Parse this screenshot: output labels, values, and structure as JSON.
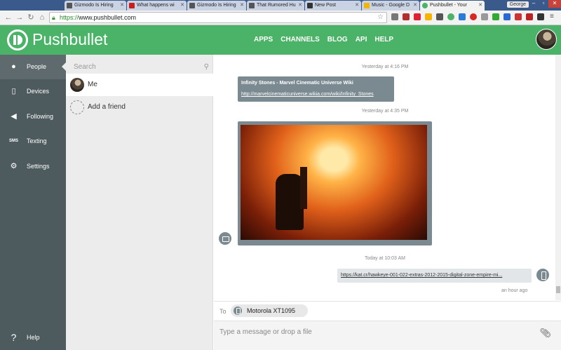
{
  "browser": {
    "tabs": [
      {
        "label": "Gizmodo Is Hiring",
        "icon": "gizmodo-favicon",
        "color": "#555555"
      },
      {
        "label": "What happens wi",
        "icon": "s-favicon",
        "color": "#c81e1e"
      },
      {
        "label": "Gizmodo Is Hiring",
        "icon": "gizmodo-favicon",
        "color": "#555555"
      },
      {
        "label": "That Rumored Hu",
        "icon": "gizmodo-favicon",
        "color": "#555555"
      },
      {
        "label": "New Post",
        "icon": "blog-favicon",
        "color": "#333333"
      },
      {
        "label": "Music - Google D",
        "icon": "drive-favicon",
        "color": "#f4b400"
      },
      {
        "label": "Pushbullet - Your",
        "icon": "pushbullet-favicon",
        "color": "#4ab367",
        "active": true
      }
    ],
    "user": "George",
    "url_scheme": "https://",
    "url_rest": "www.pushbullet.com"
  },
  "app": {
    "brand": "Pushbullet",
    "nav": [
      "APPS",
      "CHANNELS",
      "BLOG",
      "API",
      "HELP"
    ],
    "accent": "#4ab367"
  },
  "sidebar": {
    "items": [
      {
        "label": "People",
        "icon": "chat-bubble-icon"
      },
      {
        "label": "Devices",
        "icon": "phone-icon"
      },
      {
        "label": "Following",
        "icon": "megaphone-icon"
      },
      {
        "label": "Texting",
        "icon": "sms-icon",
        "glyph": "SMS"
      },
      {
        "label": "Settings",
        "icon": "gear-icon"
      }
    ],
    "help": "Help"
  },
  "friends": {
    "search_placeholder": "Search",
    "items": [
      {
        "name": "Me"
      },
      {
        "name": "Add a friend"
      }
    ]
  },
  "chat": {
    "messages": [
      {
        "timestamp": "Yesterday at 4:16 PM",
        "title": "Infinity Stones - Marvel Cinematic Universe Wiki",
        "link": "http://marvelcinematicuniverse.wikia.com/wiki/Infinity_Stones"
      },
      {
        "timestamp": "Yesterday at 4:35 PM",
        "image": true
      },
      {
        "timestamp": "Today at 10:03 AM",
        "link": "https://kat.cr/hawkeye-001-022-extras-2012-2015-digital-zone-empire-mi...",
        "ago": "an hour ago"
      }
    ],
    "to_label": "To",
    "device": "Motorola XT1095",
    "compose_placeholder": "Type a message or drop a file"
  }
}
